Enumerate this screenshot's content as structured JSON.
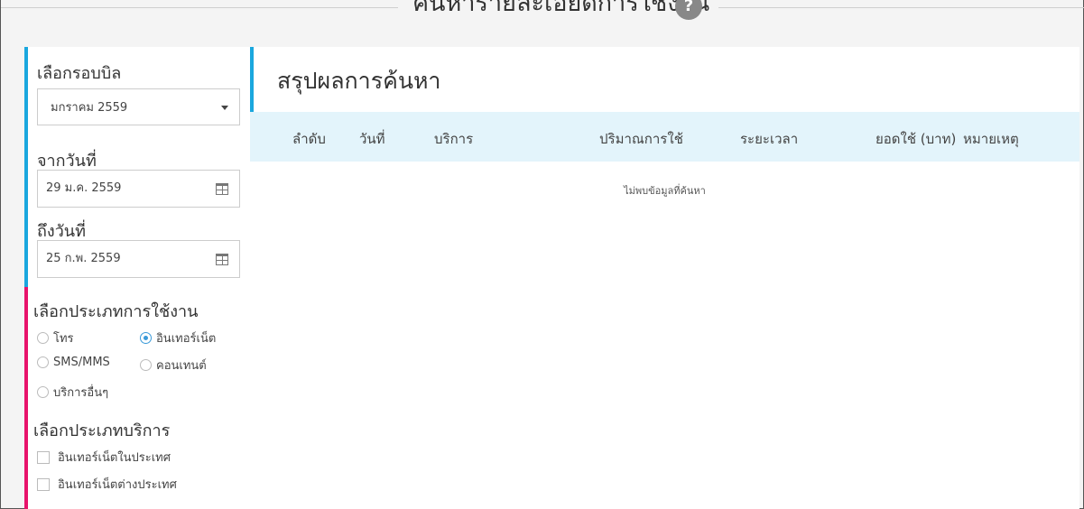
{
  "header": {
    "title": "ค้นหารายละเอียดการใช้งาน",
    "help_symbol": "?"
  },
  "sidebar": {
    "bill_cycle": {
      "label": "เลือกรอบบิล",
      "selected": "มกราคม 2559"
    },
    "from_date": {
      "label": "จากวันที่",
      "value": "29 ม.ค. 2559"
    },
    "to_date": {
      "label": "ถึงวันที่",
      "value": "25 ก.พ. 2559"
    },
    "usage_type": {
      "label": "เลือกประเภทการใช้งาน",
      "options": [
        {
          "label": "โทร",
          "checked": false
        },
        {
          "label": "อินเทอร์เน็ต",
          "checked": true
        },
        {
          "label": "SMS/MMS",
          "checked": false
        },
        {
          "label": "คอนเทนต์",
          "checked": false
        },
        {
          "label": "บริการอื่นๆ",
          "checked": false
        }
      ]
    },
    "service_type": {
      "label": "เลือกประเภทบริการ",
      "options": [
        {
          "label": "อินเทอร์เน็ตในประเทศ",
          "checked": false
        },
        {
          "label": "อินเทอร์เน็ตต่างประเทศ",
          "checked": false
        }
      ]
    }
  },
  "main": {
    "title": "สรุปผลการค้นหา",
    "columns": [
      "ลำดับ",
      "วันที่",
      "บริการ",
      "ปริมาณการใช้",
      "ระยะเวลา",
      "ยอดใช้ (บาท)",
      "หมายเหตุ"
    ],
    "empty_message": "ไม่พบข้อมูลที่ค้นหา"
  },
  "colors": {
    "accent_blue": "#1aa7de",
    "accent_pink": "#e8136b",
    "table_header_bg": "#e3f4fb"
  }
}
